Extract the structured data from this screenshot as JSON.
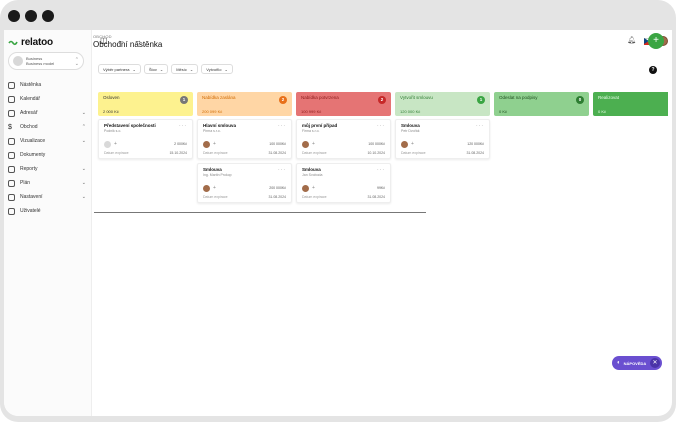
{
  "app": {
    "logo_text": "relatoo"
  },
  "company": {
    "line1": "Business",
    "line2": "Business model"
  },
  "nav": [
    {
      "label": "Nástěnka",
      "icon": "dashboard-icon",
      "caret": ""
    },
    {
      "label": "Kalendář",
      "icon": "calendar-icon",
      "caret": ""
    },
    {
      "label": "Adresář",
      "icon": "contacts-icon",
      "caret": "⌄"
    },
    {
      "label": "Obchod",
      "icon": "dollar-icon",
      "caret": "⌃"
    },
    {
      "label": "Vizualizace",
      "icon": "eye-icon",
      "caret": "⌄"
    },
    {
      "label": "Dokumenty",
      "icon": "document-icon",
      "caret": ""
    },
    {
      "label": "Reporty",
      "icon": "chart-icon",
      "caret": "⌄"
    },
    {
      "label": "Plán",
      "icon": "plan-icon",
      "caret": "⌄"
    },
    {
      "label": "Nastavení",
      "icon": "gear-icon",
      "caret": "⌄"
    },
    {
      "label": "Uživatelé",
      "icon": "users-icon",
      "caret": ""
    }
  ],
  "page": {
    "breadcrumb": "OBCHOD",
    "title": "Obchodní nástěnka",
    "add_label": "+"
  },
  "filters": [
    "Výběr partnera",
    "Štov",
    "Měsíc",
    "Vytvořilo"
  ],
  "help_label": "?",
  "columns": [
    {
      "name": "Osloven",
      "sum": "2 000 Kč",
      "count": "1",
      "bg": "#fdf28f",
      "text": "#333",
      "badge": "#777",
      "cards": [
        {
          "title": "Představení společnosti",
          "sub": "Podnik s.o.",
          "avatar": "gray",
          "amount": "2 000Kč",
          "date_label": "Datum expirace",
          "date": "15.10.2024"
        }
      ]
    },
    {
      "name": "Nabídka zaslána",
      "sum": "200 099 Kč",
      "count": "2",
      "bg": "#ffd6a5",
      "text": "#d06a00",
      "badge": "#e8701a",
      "cards": [
        {
          "title": "Hlavní smlouva",
          "sub": "Pirma s.r.o.",
          "avatar": "photo",
          "amount": "100 000Kč",
          "date_label": "Datum expirace",
          "date": "31.08.2024"
        },
        {
          "title": "Smlouva",
          "sub": "Ing. Martin Prokop",
          "avatar": "photo",
          "amount": "200 000Kč",
          "date_label": "Datum expirace",
          "date": "31.08.2024"
        }
      ]
    },
    {
      "name": "Nabídka potvrzena",
      "sum": "100 999 Kč",
      "count": "2",
      "bg": "#e57474",
      "text": "#8b1a1a",
      "badge": "#c62828",
      "cards": [
        {
          "title": "můj první případ",
          "sub": "Firma s.r.o.",
          "avatar": "photo",
          "amount": "100 000Kč",
          "date_label": "Datum expirace",
          "date": "10.10.2024"
        },
        {
          "title": "Smlouva",
          "sub": "Jan Svoboda",
          "avatar": "photo",
          "amount": "99Kč",
          "date_label": "Datum expirace",
          "date": "31.08.2024"
        }
      ]
    },
    {
      "name": "Vytvořit smlouvu",
      "sum": "120 000 Kč",
      "count": "1",
      "bg": "#c8e6c4",
      "text": "#2f7d33",
      "badge": "#3aa543",
      "cards": [
        {
          "title": "Smlouva",
          "sub": "Petr Dvořák",
          "avatar": "photo",
          "amount": "120 000Kč",
          "date_label": "Datum expirace",
          "date": "31.08.2024"
        }
      ]
    },
    {
      "name": "Odeslat na podpisy",
      "sum": "0 Kč",
      "count": "0",
      "bg": "#8fd08f",
      "text": "#1f4f1f",
      "badge": "#2e7d32",
      "cards": []
    },
    {
      "name": "Realizovat",
      "sum": "0 Kč",
      "count": "",
      "bg": "#4caf50",
      "text": "#eaffea",
      "badge": "",
      "cards": []
    }
  ],
  "assistant": {
    "label": "NÁPOVĚDA",
    "close": "✕"
  }
}
